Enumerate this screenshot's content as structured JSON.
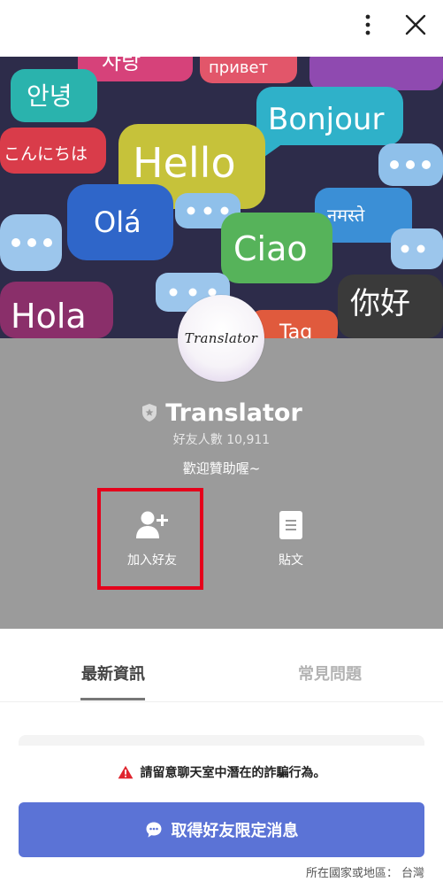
{
  "header": {
    "more_icon": "vertical-dots-icon",
    "close_icon": "close-icon"
  },
  "cover": {
    "bubbles": [
      "사랑",
      "привет",
      "안녕",
      "Bonjour",
      "こんにちは",
      "Hello",
      "Olá",
      "नमस्ते",
      "Ciao",
      "你好",
      "Hola",
      "Tag"
    ]
  },
  "profile": {
    "avatar_text": "Translator",
    "name": "Translator",
    "friend_count": "好友人數 10,911",
    "welcome": "歡迎贊助喔~",
    "badge_icon": "shield-icon"
  },
  "actions": {
    "add_friend": "加入好友",
    "posts": "貼文"
  },
  "tabs": {
    "news": "最新資訊",
    "faq": "常見問題"
  },
  "warning": {
    "text": "請留意聊天室中潛在的詐騙行為。"
  },
  "cta": {
    "label": "取得好友限定消息"
  },
  "footer": {
    "region_label": "所在國家或地區：",
    "region_value": "台灣"
  },
  "colors": {
    "profile_bg": "#9b9b9b",
    "cta_bg": "#5b73d6",
    "highlight": "#e5001b",
    "warning": "#e0262f"
  }
}
